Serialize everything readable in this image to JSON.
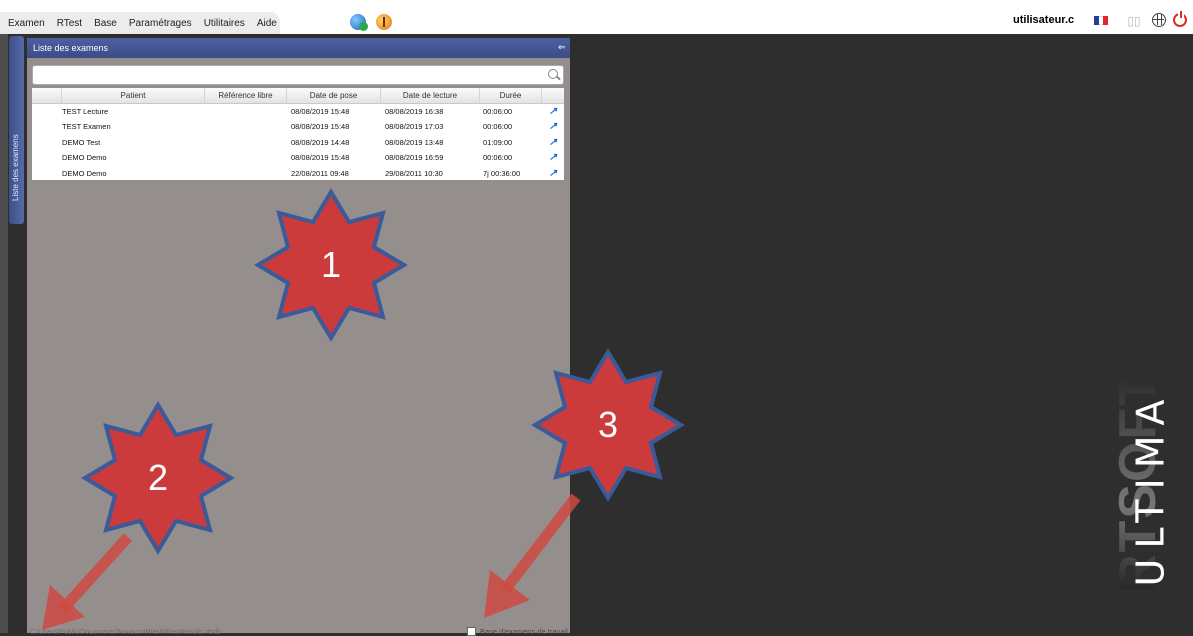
{
  "menu": {
    "items": [
      "Examen",
      "RTest",
      "Base",
      "Paramétrages",
      "Utilitaires",
      "Aide"
    ]
  },
  "header": {
    "username": "utilisateur.c",
    "icons": [
      "sync-icon",
      "alert-icon",
      "french-flag-icon",
      "card-reader-icon",
      "globe-icon",
      "power-icon"
    ],
    "flag_colors": [
      "#1f3fa0",
      "#ffffff",
      "#e0252d"
    ]
  },
  "sidetab": {
    "label": "Liste des examens"
  },
  "panel": {
    "title": "Liste des examens",
    "search": {
      "value": "",
      "placeholder": ""
    },
    "columns": [
      "",
      "Patient",
      "Référence libre",
      "Date de pose",
      "Date de lecture",
      "Durée",
      ""
    ],
    "rows": [
      {
        "patient": "TEST Lecture",
        "reference": "",
        "date_pose": "08/08/2019 15:48",
        "date_lecture": "08/08/2019 16:38",
        "duree": "00:06:00"
      },
      {
        "patient": "TEST Examen",
        "reference": "",
        "date_pose": "08/08/2019 15:48",
        "date_lecture": "08/08/2019 17:03",
        "duree": "00:06:00"
      },
      {
        "patient": "DEMO Test",
        "reference": "",
        "date_pose": "08/08/2019 14:48",
        "date_lecture": "08/08/2019 13:48",
        "duree": "01:09:00"
      },
      {
        "patient": "DEMO Demo",
        "reference": "",
        "date_pose": "08/08/2019 15:48",
        "date_lecture": "08/08/2019 16:59",
        "duree": "00:06:00"
      },
      {
        "patient": "DEMO Demo",
        "reference": "",
        "date_pose": "22/08/2011 09:48",
        "date_lecture": "29/08/2011 10:30",
        "duree": "7j 00:36:00"
      }
    ],
    "footer_path": "C:\\Users\\Public\\Documents\\Novacor\\Rtest\\RtestResults.rtsdb",
    "work_base_label": "Base d'examens de travail",
    "work_base_checked": false
  },
  "annotations": {
    "star_labels": [
      "1",
      "2",
      "3"
    ],
    "star_color": "#cc3b3b",
    "star_border": "#3a5a9a",
    "arrow_color": "#cf4a43"
  },
  "logo": {
    "brand": "RTSOFT",
    "product": "ULTIMA"
  }
}
